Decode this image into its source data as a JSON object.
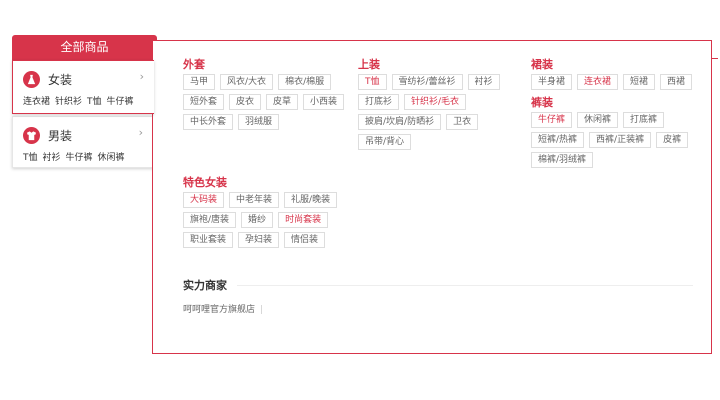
{
  "sidebar": {
    "header": "全部商品",
    "categories": [
      {
        "name": "女装",
        "arrow": "›",
        "links": [
          "连衣裙",
          "针织衫",
          "T恤",
          "牛仔裤"
        ]
      },
      {
        "name": "男装",
        "arrow": "›",
        "links": [
          "T恤",
          "衬衫",
          "牛仔裤",
          "休闲裤"
        ]
      }
    ]
  },
  "panel": {
    "sections": {
      "outer": {
        "title": "外套",
        "tags": [
          "马甲",
          "风衣/大衣",
          "棉衣/棉服",
          "短外套",
          "皮衣",
          "皮草",
          "小西装",
          "中长外套",
          "羽绒服"
        ]
      },
      "top": {
        "title": "上装",
        "tags": [
          "T恤",
          "雪纺衫/蕾丝衫",
          "衬衫",
          "打底衫",
          "针织衫/毛衣",
          "披肩/坎肩/防晒衫",
          "卫衣",
          "吊带/背心"
        ]
      },
      "skirt": {
        "title": "裙装",
        "tags": [
          "半身裙",
          "连衣裙",
          "短裙",
          "西裙"
        ]
      },
      "pants": {
        "title": "裤装",
        "tags": [
          "牛仔裤",
          "休闲裤",
          "打底裤",
          "短裤/热裤",
          "西裤/正装裤",
          "皮裤",
          "棉裤/羽绒裤"
        ]
      },
      "special": {
        "title": "特色女装",
        "tags": [
          "大码装",
          "中老年装",
          "礼服/晚装",
          "旗袍/唐装",
          "婚纱",
          "时尚套装",
          "职业套装",
          "孕妇装",
          "情侣装"
        ]
      }
    },
    "merchants": {
      "title": "实力商家",
      "links": [
        "呵呵哩官方旗舰店"
      ],
      "separator": "|"
    }
  },
  "colors": {
    "accent": "#d7344a",
    "tag_border": "#dddddd"
  },
  "icons": {
    "women": "dress-icon",
    "men": "shirt-icon"
  }
}
